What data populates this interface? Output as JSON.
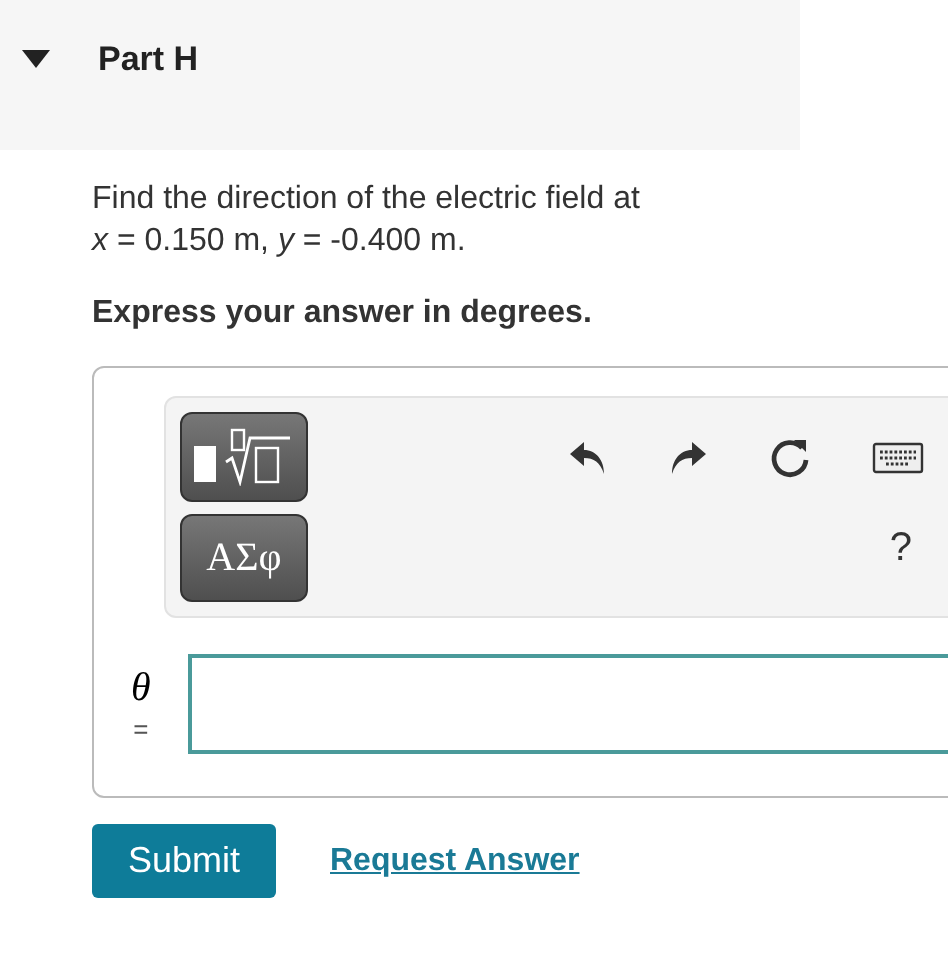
{
  "part": {
    "title": "Part H",
    "expanded": true
  },
  "question": {
    "lines": [
      "Find the direction of the electric field at",
      "*x* = 0.150 m, *y* = -0.400 m."
    ],
    "instruction": "Express your answer in degrees."
  },
  "toolbar": {
    "symbols_button": "ΑΣφ",
    "help": "?"
  },
  "answer": {
    "variable": "θ",
    "equals": "="
  },
  "buttons": {
    "submit": "Submit",
    "request": "Request Answer"
  }
}
